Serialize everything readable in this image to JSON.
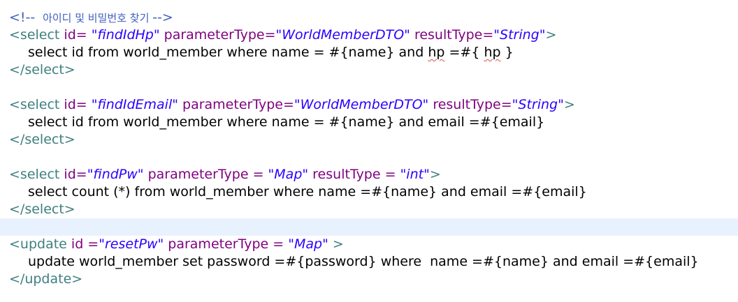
{
  "colors": {
    "comment": "#3f5fbf",
    "tag": "#3f7f7f",
    "attribute": "#7f007f",
    "value": "#2a00ff",
    "text": "#000000",
    "current_line_highlight": "#e8f2fe",
    "spell_error": "#e05050"
  },
  "lines": {
    "l1": {
      "c1": "<!-- ",
      "c2": " 아이디 및 비밀번호 찾기 ",
      "c3": "-->"
    },
    "l2": {
      "t1": "<select",
      "a1": " id=",
      "v1": " \"findIdHp\"",
      "a2": " parameterType=",
      "v2": "\"WorldMemberDTO\"",
      "a3": " resultType=",
      "v3": "\"String\"",
      "t2": ">"
    },
    "l3": {
      "s1": "select id from world_member where name = #{name} and ",
      "s2": "hp",
      "s3": " =#{ ",
      "s4": "hp",
      "s5": " }"
    },
    "l4": {
      "t1": "</select>"
    },
    "l5": {
      "text": ""
    },
    "l6": {
      "t1": "<select",
      "a1": " id=",
      "v1": " \"findIdEmail\"",
      "a2": " parameterType=",
      "v2": "\"WorldMemberDTO\"",
      "a3": " resultType=",
      "v3": "\"String\"",
      "t2": ">"
    },
    "l7": {
      "s1": "select id from world_member where name = #{name} and email =#{email}"
    },
    "l8": {
      "t1": "</select>"
    },
    "l9": {
      "text": ""
    },
    "l10": {
      "t1": "<select",
      "a1": " id=",
      "v1": "\"findPw\"",
      "a2": " parameterType = ",
      "v2": "\"Map\"",
      "a3": " resultType = ",
      "v3": "\"int\"",
      "t2": ">"
    },
    "l11": {
      "s1": "select count (*) from world_member where name =#{name} and email =#{email}"
    },
    "l12": {
      "t1": "</select>"
    },
    "l13": {
      "text": ""
    },
    "l14": {
      "t1": "<update",
      "a1": " id =",
      "v1": "\"resetPw\"",
      "a2": " parameterType = ",
      "v2": "\"Map\"",
      "t2": " >"
    },
    "l15": {
      "s1": "update world_member set password =#{password} where  name =#{name} and email =#{email}"
    },
    "l16": {
      "t1": "</update>"
    }
  }
}
